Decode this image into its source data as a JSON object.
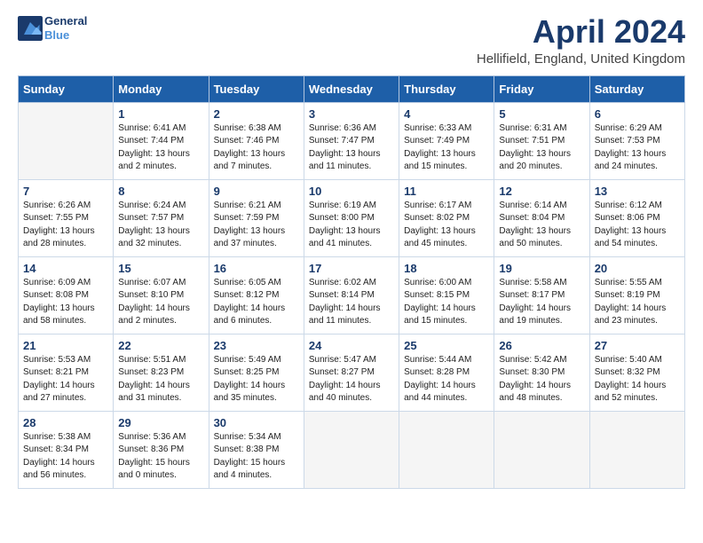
{
  "header": {
    "logo_line1": "General",
    "logo_line2": "Blue",
    "month_title": "April 2024",
    "location": "Hellifield, England, United Kingdom"
  },
  "days_of_week": [
    "Sunday",
    "Monday",
    "Tuesday",
    "Wednesday",
    "Thursday",
    "Friday",
    "Saturday"
  ],
  "weeks": [
    [
      {
        "day": "",
        "text": ""
      },
      {
        "day": "1",
        "text": "Sunrise: 6:41 AM\nSunset: 7:44 PM\nDaylight: 13 hours\nand 2 minutes."
      },
      {
        "day": "2",
        "text": "Sunrise: 6:38 AM\nSunset: 7:46 PM\nDaylight: 13 hours\nand 7 minutes."
      },
      {
        "day": "3",
        "text": "Sunrise: 6:36 AM\nSunset: 7:47 PM\nDaylight: 13 hours\nand 11 minutes."
      },
      {
        "day": "4",
        "text": "Sunrise: 6:33 AM\nSunset: 7:49 PM\nDaylight: 13 hours\nand 15 minutes."
      },
      {
        "day": "5",
        "text": "Sunrise: 6:31 AM\nSunset: 7:51 PM\nDaylight: 13 hours\nand 20 minutes."
      },
      {
        "day": "6",
        "text": "Sunrise: 6:29 AM\nSunset: 7:53 PM\nDaylight: 13 hours\nand 24 minutes."
      }
    ],
    [
      {
        "day": "7",
        "text": "Sunrise: 6:26 AM\nSunset: 7:55 PM\nDaylight: 13 hours\nand 28 minutes."
      },
      {
        "day": "8",
        "text": "Sunrise: 6:24 AM\nSunset: 7:57 PM\nDaylight: 13 hours\nand 32 minutes."
      },
      {
        "day": "9",
        "text": "Sunrise: 6:21 AM\nSunset: 7:59 PM\nDaylight: 13 hours\nand 37 minutes."
      },
      {
        "day": "10",
        "text": "Sunrise: 6:19 AM\nSunset: 8:00 PM\nDaylight: 13 hours\nand 41 minutes."
      },
      {
        "day": "11",
        "text": "Sunrise: 6:17 AM\nSunset: 8:02 PM\nDaylight: 13 hours\nand 45 minutes."
      },
      {
        "day": "12",
        "text": "Sunrise: 6:14 AM\nSunset: 8:04 PM\nDaylight: 13 hours\nand 50 minutes."
      },
      {
        "day": "13",
        "text": "Sunrise: 6:12 AM\nSunset: 8:06 PM\nDaylight: 13 hours\nand 54 minutes."
      }
    ],
    [
      {
        "day": "14",
        "text": "Sunrise: 6:09 AM\nSunset: 8:08 PM\nDaylight: 13 hours\nand 58 minutes."
      },
      {
        "day": "15",
        "text": "Sunrise: 6:07 AM\nSunset: 8:10 PM\nDaylight: 14 hours\nand 2 minutes."
      },
      {
        "day": "16",
        "text": "Sunrise: 6:05 AM\nSunset: 8:12 PM\nDaylight: 14 hours\nand 6 minutes."
      },
      {
        "day": "17",
        "text": "Sunrise: 6:02 AM\nSunset: 8:14 PM\nDaylight: 14 hours\nand 11 minutes."
      },
      {
        "day": "18",
        "text": "Sunrise: 6:00 AM\nSunset: 8:15 PM\nDaylight: 14 hours\nand 15 minutes."
      },
      {
        "day": "19",
        "text": "Sunrise: 5:58 AM\nSunset: 8:17 PM\nDaylight: 14 hours\nand 19 minutes."
      },
      {
        "day": "20",
        "text": "Sunrise: 5:55 AM\nSunset: 8:19 PM\nDaylight: 14 hours\nand 23 minutes."
      }
    ],
    [
      {
        "day": "21",
        "text": "Sunrise: 5:53 AM\nSunset: 8:21 PM\nDaylight: 14 hours\nand 27 minutes."
      },
      {
        "day": "22",
        "text": "Sunrise: 5:51 AM\nSunset: 8:23 PM\nDaylight: 14 hours\nand 31 minutes."
      },
      {
        "day": "23",
        "text": "Sunrise: 5:49 AM\nSunset: 8:25 PM\nDaylight: 14 hours\nand 35 minutes."
      },
      {
        "day": "24",
        "text": "Sunrise: 5:47 AM\nSunset: 8:27 PM\nDaylight: 14 hours\nand 40 minutes."
      },
      {
        "day": "25",
        "text": "Sunrise: 5:44 AM\nSunset: 8:28 PM\nDaylight: 14 hours\nand 44 minutes."
      },
      {
        "day": "26",
        "text": "Sunrise: 5:42 AM\nSunset: 8:30 PM\nDaylight: 14 hours\nand 48 minutes."
      },
      {
        "day": "27",
        "text": "Sunrise: 5:40 AM\nSunset: 8:32 PM\nDaylight: 14 hours\nand 52 minutes."
      }
    ],
    [
      {
        "day": "28",
        "text": "Sunrise: 5:38 AM\nSunset: 8:34 PM\nDaylight: 14 hours\nand 56 minutes."
      },
      {
        "day": "29",
        "text": "Sunrise: 5:36 AM\nSunset: 8:36 PM\nDaylight: 15 hours\nand 0 minutes."
      },
      {
        "day": "30",
        "text": "Sunrise: 5:34 AM\nSunset: 8:38 PM\nDaylight: 15 hours\nand 4 minutes."
      },
      {
        "day": "",
        "text": ""
      },
      {
        "day": "",
        "text": ""
      },
      {
        "day": "",
        "text": ""
      },
      {
        "day": "",
        "text": ""
      }
    ]
  ]
}
